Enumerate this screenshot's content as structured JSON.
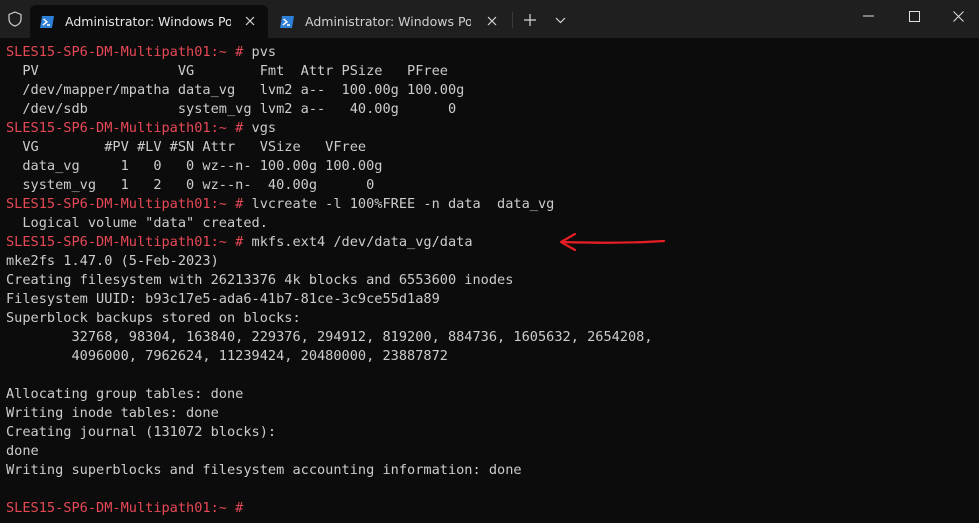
{
  "tabs": [
    {
      "label": "Administrator: Windows PowerShell",
      "active": true
    },
    {
      "label": "Administrator: Windows PowerShell",
      "active": false
    }
  ],
  "icons": {
    "shield": "shield-icon",
    "powershell": "powershell-icon",
    "close": "close-icon",
    "new_tab": "plus-icon",
    "dropdown": "chevron-down-icon",
    "minimize": "minimize-icon",
    "maximize": "maximize-icon",
    "window_close": "close-icon",
    "annotation": "red-arrow-icon"
  },
  "colors": {
    "background": "#0c0c0c",
    "titlebar": "#1f1f1f",
    "text": "#cccccc",
    "prompt": "#e74856",
    "annotation_arrow": "#e81e25"
  },
  "terminal": {
    "lines": [
      {
        "prompt": "SLES15-SP6-DM-Multipath01:~ #",
        "text": " pvs"
      },
      {
        "prompt": "",
        "text": "  PV                 VG        Fmt  Attr PSize   PFree"
      },
      {
        "prompt": "",
        "text": "  /dev/mapper/mpatha data_vg   lvm2 a--  100.00g 100.00g"
      },
      {
        "prompt": "",
        "text": "  /dev/sdb           system_vg lvm2 a--   40.00g      0"
      },
      {
        "prompt": "SLES15-SP6-DM-Multipath01:~ #",
        "text": " vgs"
      },
      {
        "prompt": "",
        "text": "  VG        #PV #LV #SN Attr   VSize   VFree"
      },
      {
        "prompt": "",
        "text": "  data_vg     1   0   0 wz--n- 100.00g 100.00g"
      },
      {
        "prompt": "",
        "text": "  system_vg   1   2   0 wz--n-  40.00g      0"
      },
      {
        "prompt": "SLES15-SP6-DM-Multipath01:~ #",
        "text": " lvcreate -l 100%FREE -n data  data_vg"
      },
      {
        "prompt": "",
        "text": "  Logical volume \"data\" created."
      },
      {
        "prompt": "SLES15-SP6-DM-Multipath01:~ #",
        "text": " mkfs.ext4 /dev/data_vg/data"
      },
      {
        "prompt": "",
        "text": "mke2fs 1.47.0 (5-Feb-2023)"
      },
      {
        "prompt": "",
        "text": "Creating filesystem with 26213376 4k blocks and 6553600 inodes"
      },
      {
        "prompt": "",
        "text": "Filesystem UUID: b93c17e5-ada6-41b7-81ce-3c9ce55d1a89"
      },
      {
        "prompt": "",
        "text": "Superblock backups stored on blocks:"
      },
      {
        "prompt": "",
        "text": "        32768, 98304, 163840, 229376, 294912, 819200, 884736, 1605632, 2654208,"
      },
      {
        "prompt": "",
        "text": "        4096000, 7962624, 11239424, 20480000, 23887872"
      },
      {
        "prompt": "",
        "text": ""
      },
      {
        "prompt": "",
        "text": "Allocating group tables: done"
      },
      {
        "prompt": "",
        "text": "Writing inode tables: done"
      },
      {
        "prompt": "",
        "text": "Creating journal (131072 blocks):"
      },
      {
        "prompt": "",
        "text": "done"
      },
      {
        "prompt": "",
        "text": "Writing superblocks and filesystem accounting information: done"
      },
      {
        "prompt": "",
        "text": ""
      },
      {
        "prompt": "SLES15-SP6-DM-Multipath01:~ #",
        "text": ""
      }
    ]
  }
}
